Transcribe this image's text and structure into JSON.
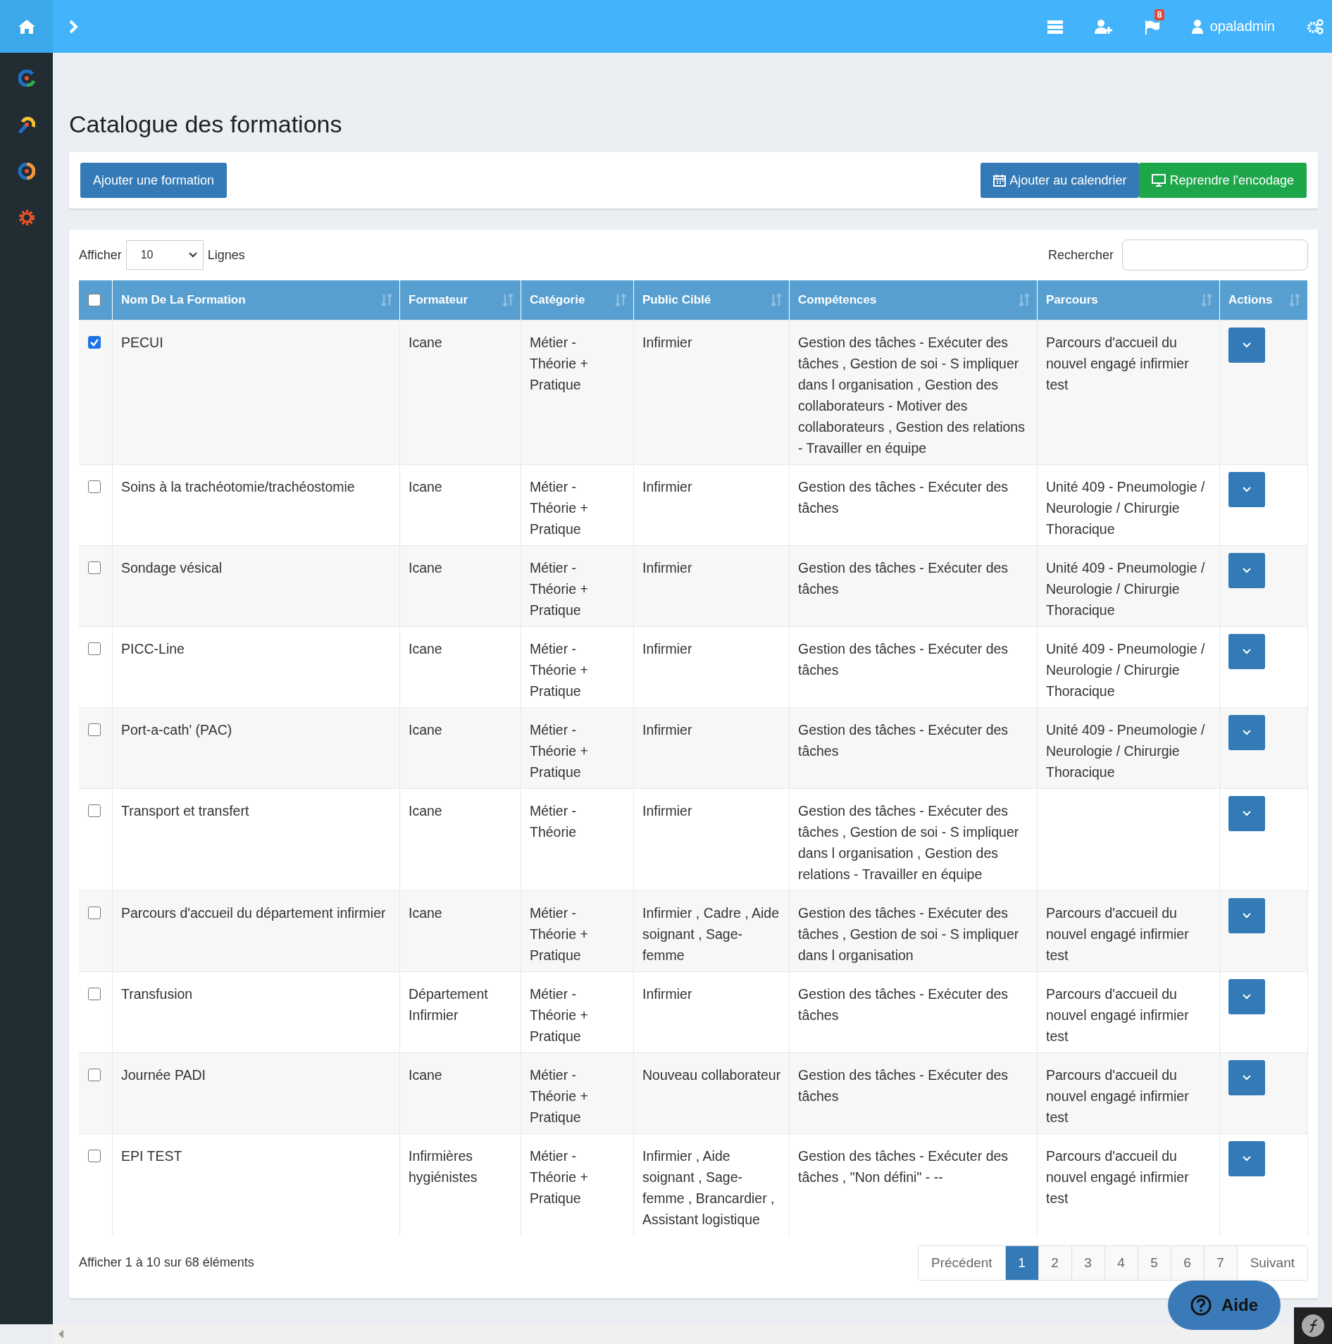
{
  "topbar": {
    "username": "opaladmin",
    "notifications_badge": "8"
  },
  "page": {
    "title": "Catalogue des formations"
  },
  "toolbar": {
    "add_button": "Ajouter une formation",
    "calendar_button": "Ajouter au calendrier",
    "resume_button": "Reprendre l'encodage"
  },
  "table_controls": {
    "show_label": "Afficher",
    "page_size": "10",
    "rows_label": "Lignes",
    "search_label": "Rechercher"
  },
  "table": {
    "select_all_checked": false,
    "columns": [
      "Nom De La Formation",
      "Formateur",
      "Catégorie",
      "Public Ciblé",
      "Compétences",
      "Parcours",
      "Actions"
    ],
    "rows": [
      {
        "selected": true,
        "cells": [
          "PECUI",
          "Icane",
          "Métier - Théorie + Pratique",
          "Infirmier",
          "Gestion des tâches - Exécuter des tâches , Gestion de soi - S impliquer dans l organisation , Gestion des collaborateurs - Motiver des collaborateurs , Gestion des relations - Travailler en équipe",
          "Parcours d'accueil du nouvel engagé infirmier test"
        ]
      },
      {
        "selected": false,
        "cells": [
          "Soins à la trachéotomie/trachéostomie",
          "Icane",
          "Métier - Théorie + Pratique",
          "Infirmier",
          "Gestion des tâches - Exécuter des tâches",
          "Unité 409 - Pneumologie / Neurologie / Chirurgie Thoracique"
        ]
      },
      {
        "selected": false,
        "cells": [
          "Sondage vésical",
          "Icane",
          "Métier - Théorie + Pratique",
          "Infirmier",
          "Gestion des tâches - Exécuter des tâches",
          "Unité 409 - Pneumologie / Neurologie / Chirurgie Thoracique"
        ]
      },
      {
        "selected": false,
        "cells": [
          "PICC-Line",
          "Icane",
          "Métier - Théorie + Pratique",
          "Infirmier",
          "Gestion des tâches - Exécuter des tâches",
          "Unité 409 - Pneumologie / Neurologie / Chirurgie Thoracique"
        ]
      },
      {
        "selected": false,
        "cells": [
          "Port-a-cath' (PAC)",
          "Icane",
          "Métier - Théorie + Pratique",
          "Infirmier",
          "Gestion des tâches - Exécuter des tâches",
          "Unité 409 - Pneumologie / Neurologie / Chirurgie Thoracique"
        ]
      },
      {
        "selected": false,
        "cells": [
          "Transport et transfert",
          "Icane",
          "Métier - Théorie",
          "Infirmier",
          "Gestion des tâches - Exécuter des tâches , Gestion de soi - S impliquer dans l organisation , Gestion des relations - Travailler en équipe",
          ""
        ]
      },
      {
        "selected": false,
        "cells": [
          "Parcours d'accueil du département infirmier",
          "Icane",
          "Métier - Théorie + Pratique",
          "Infirmier , Cadre , Aide soignant , Sage-femme",
          "Gestion des tâches - Exécuter des tâches , Gestion de soi - S impliquer dans l organisation",
          "Parcours d'accueil du nouvel engagé infirmier test"
        ]
      },
      {
        "selected": false,
        "cells": [
          "Transfusion",
          "Département Infirmier",
          "Métier - Théorie + Pratique",
          "Infirmier",
          "Gestion des tâches - Exécuter des tâches",
          "Parcours d'accueil du nouvel engagé infirmier test"
        ]
      },
      {
        "selected": false,
        "cells": [
          "Journée PADI",
          "Icane",
          "Métier - Théorie + Pratique",
          "Nouveau collaborateur",
          "Gestion des tâches - Exécuter des tâches",
          "Parcours d'accueil du nouvel engagé infirmier test"
        ]
      },
      {
        "selected": false,
        "cells": [
          "EPI TEST",
          "Infirmières hygiénistes",
          "Métier - Théorie + Pratique",
          "Infirmier , Aide soignant , Sage-femme , Brancardier , Assistant logistique",
          "Gestion des tâches - Exécuter des tâches , \"Non défini\" - --",
          "Parcours d'accueil du nouvel engagé infirmier test"
        ]
      }
    ]
  },
  "footer": {
    "info": "Afficher 1 à 10 sur 68 éléments",
    "previous": "Précédent",
    "next": "Suivant",
    "pages": [
      {
        "label": "1",
        "selected": true
      },
      {
        "label": "2",
        "selected": false
      },
      {
        "label": "3",
        "selected": false
      },
      {
        "label": "4",
        "selected": false
      },
      {
        "label": "5",
        "selected": false
      },
      {
        "label": "6",
        "selected": false
      },
      {
        "label": "7",
        "selected": false
      }
    ]
  },
  "help_button": "Aide"
}
